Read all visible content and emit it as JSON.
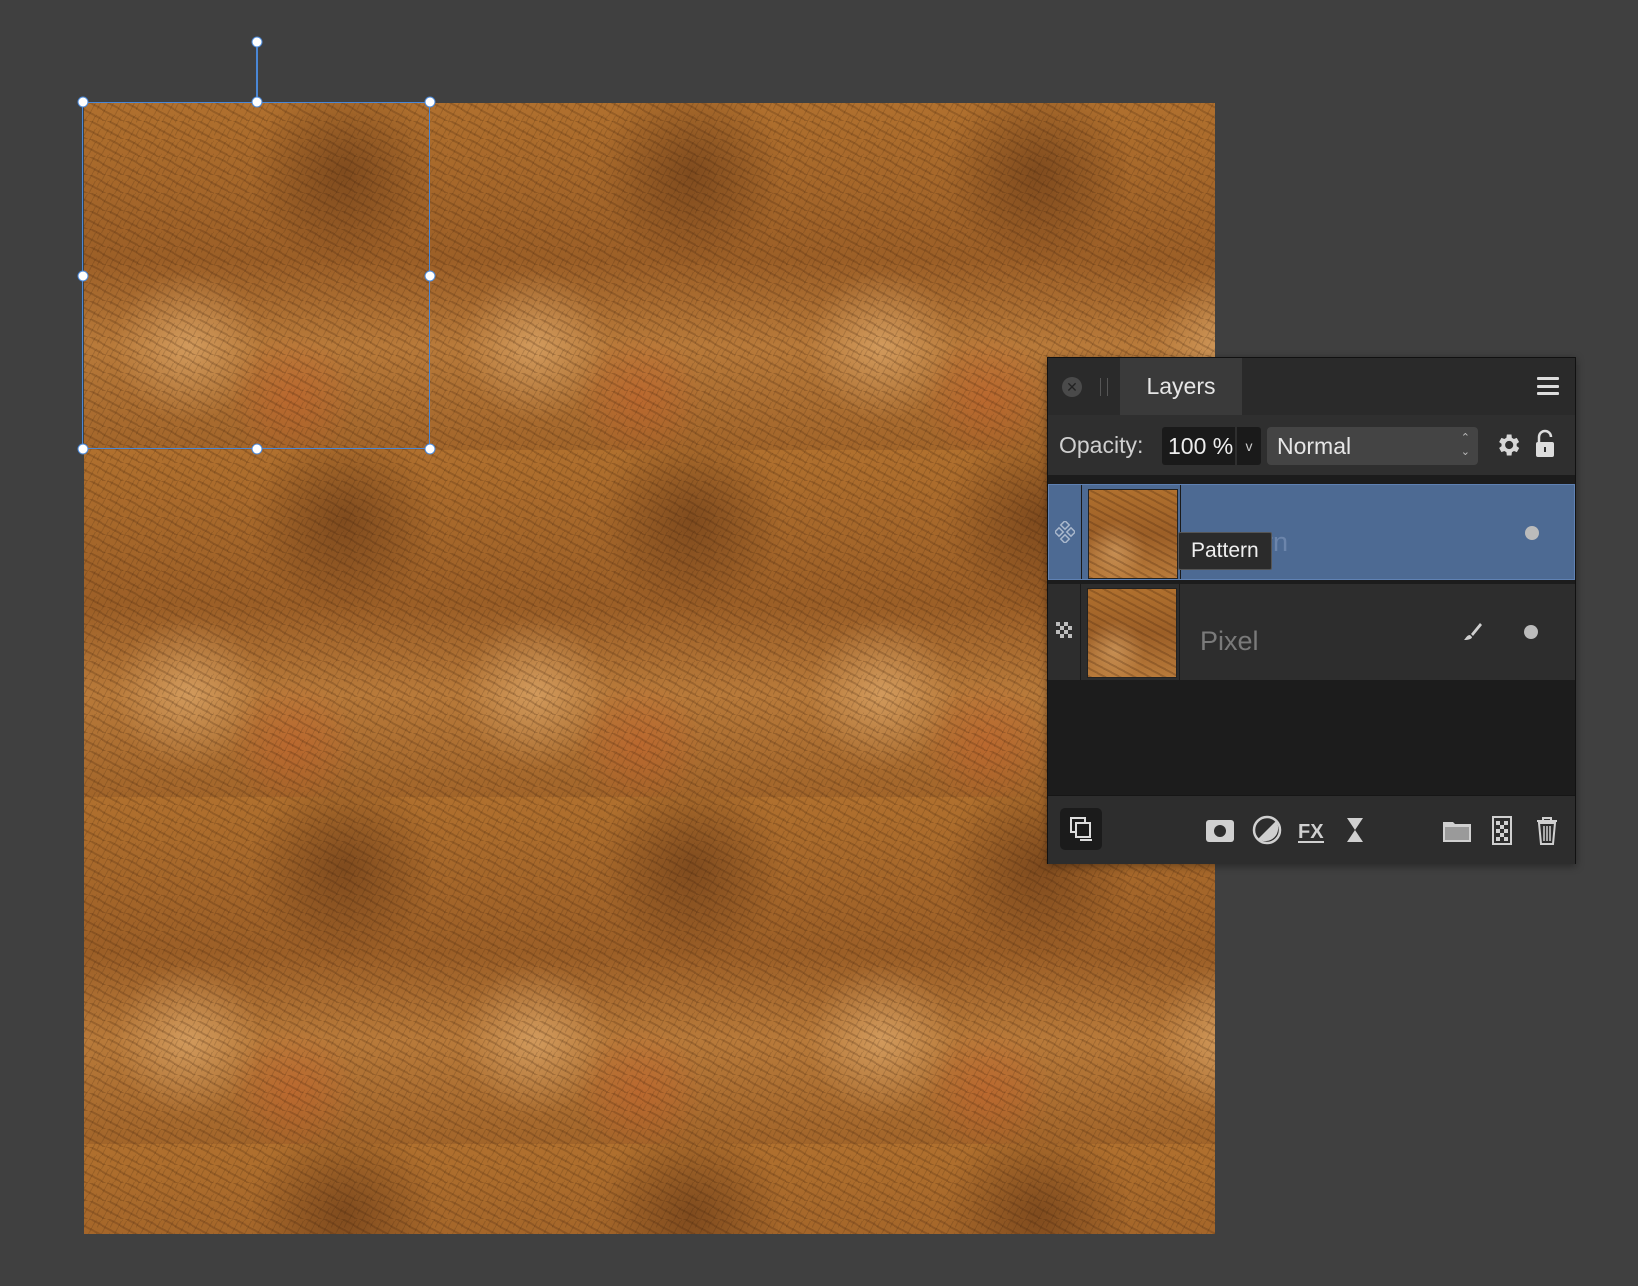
{
  "layers_panel": {
    "tab_label": "Layers",
    "opacity_label": "Opacity:",
    "opacity_value": "100 %",
    "blend_mode": "Normal",
    "layers": [
      {
        "name": "Pattern",
        "type": "pattern",
        "selected": true,
        "visible": true
      },
      {
        "name": "Pixel",
        "type": "pixel",
        "selected": false,
        "visible": true
      }
    ],
    "tooltip": "Pattern"
  },
  "icons": {
    "close": "close-icon",
    "menu": "hamburger-menu-icon",
    "settings": "gear-icon",
    "lock": "lock-icon",
    "brush": "brush-icon",
    "mask": "mask-icon",
    "adjustment": "adjustment-icon",
    "fx": "fx-icon",
    "live_filter": "hourglass-icon",
    "group": "folder-icon",
    "add_pixel": "pixel-layer-icon",
    "delete": "trash-icon",
    "arrange": "arrange-layers-icon"
  },
  "colors": {
    "selection_accent": "#4a87d6",
    "selected_row": "#4d6a93",
    "background": "#404040"
  }
}
